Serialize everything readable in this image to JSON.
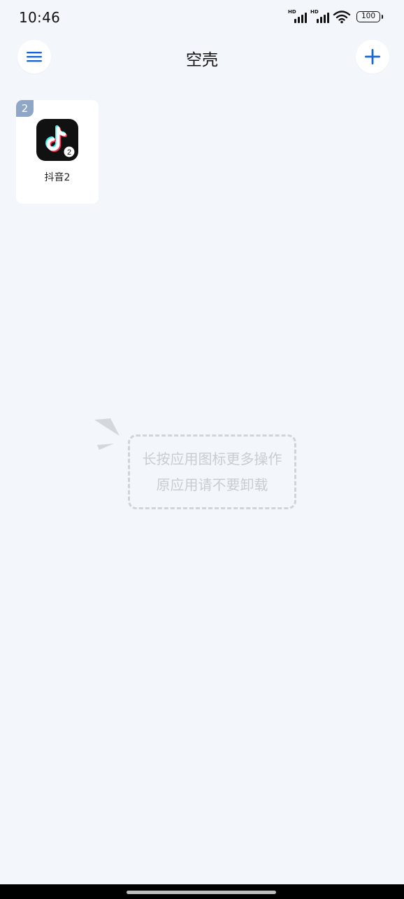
{
  "status_bar": {
    "time": "10:46",
    "sim1_label": "HD",
    "sim2_label": "HD",
    "battery_level": "100"
  },
  "header": {
    "title": "空壳",
    "menu_icon": "hamburger-menu-icon",
    "add_icon": "plus-icon",
    "accent_color": "#1a66d0"
  },
  "apps": [
    {
      "badge": "2",
      "icon_badge": "2",
      "label": "抖音2",
      "icon": "tiktok-icon"
    }
  ],
  "hint": {
    "line1": "长按应用图标更多操作",
    "line2": "原应用请不要卸载"
  },
  "colors": {
    "background": "#f3f7fb",
    "tile_badge": "#8fa6c7",
    "hint_text": "#c9ccd1"
  }
}
